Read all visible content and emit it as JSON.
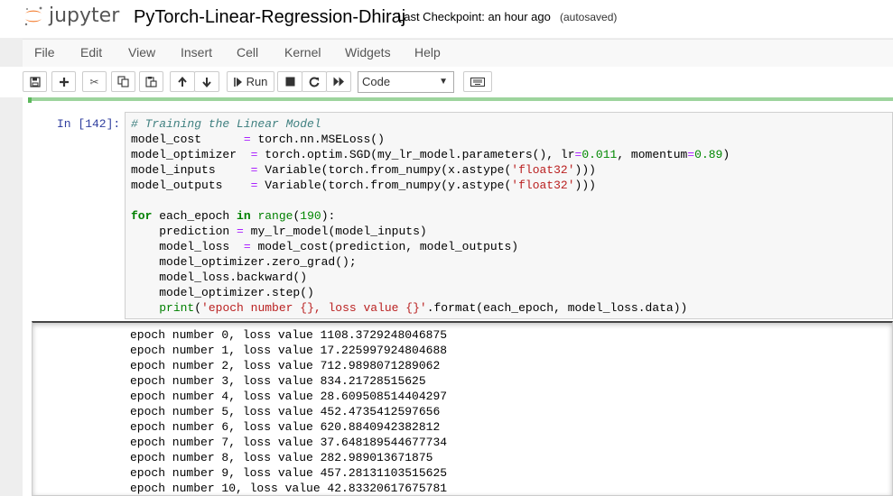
{
  "header": {
    "logo_text": "jupyter",
    "notebook_title": "PyTorch-Linear-Regression-Dhiraj",
    "checkpoint": "Last Checkpoint: an hour ago",
    "autosave": "(autosaved)"
  },
  "menu": [
    "File",
    "Edit",
    "View",
    "Insert",
    "Cell",
    "Kernel",
    "Widgets",
    "Help"
  ],
  "toolbar": {
    "icons": [
      "save-icon",
      "plus-icon",
      "cut-icon",
      "copy-icon",
      "paste-icon",
      "arrow-up-icon",
      "arrow-down-icon",
      "run-icon",
      "stop-icon",
      "restart-icon",
      "fast-forward-icon",
      "keyboard-icon"
    ],
    "run_label": "Run",
    "cell_type": "Code"
  },
  "cell": {
    "prompt": "In [142]:",
    "code": [
      [
        [
          "comment",
          "# Training the Linear Model"
        ]
      ],
      [
        [
          "",
          "model_cost      "
        ],
        [
          "operator",
          "="
        ],
        [
          "",
          " torch.nn.MSELoss()"
        ]
      ],
      [
        [
          "",
          "model_optimizer  "
        ],
        [
          "operator",
          "="
        ],
        [
          "",
          " torch.optim.SGD(my_lr_model.parameters(), lr"
        ],
        [
          "operator",
          "="
        ],
        [
          "number",
          "0.011"
        ],
        [
          "",
          ", momentum"
        ],
        [
          "operator",
          "="
        ],
        [
          "number",
          "0.89"
        ],
        [
          "",
          ")"
        ]
      ],
      [
        [
          "",
          "model_inputs     "
        ],
        [
          "operator",
          "="
        ],
        [
          "",
          " Variable(torch.from_numpy(x.astype("
        ],
        [
          "string",
          "'float32'"
        ],
        [
          "",
          ")))"
        ]
      ],
      [
        [
          "",
          "model_outputs    "
        ],
        [
          "operator",
          "="
        ],
        [
          "",
          " Variable(torch.from_numpy(y.astype("
        ],
        [
          "string",
          "'float32'"
        ],
        [
          "",
          ")))"
        ]
      ],
      [
        [
          "",
          ""
        ]
      ],
      [
        [
          "keyword",
          "for"
        ],
        [
          "",
          " each_epoch "
        ],
        [
          "keyword",
          "in"
        ],
        [
          "",
          " "
        ],
        [
          "builtin",
          "range"
        ],
        [
          "",
          "("
        ],
        [
          "number",
          "190"
        ],
        [
          "",
          "):"
        ]
      ],
      [
        [
          "",
          "    prediction "
        ],
        [
          "operator",
          "="
        ],
        [
          "",
          " my_lr_model(model_inputs)"
        ]
      ],
      [
        [
          "",
          "    model_loss  "
        ],
        [
          "operator",
          "="
        ],
        [
          "",
          " model_cost(prediction, model_outputs)"
        ]
      ],
      [
        [
          "",
          "    model_optimizer.zero_grad();"
        ]
      ],
      [
        [
          "",
          "    model_loss.backward()"
        ]
      ],
      [
        [
          "",
          "    model_optimizer.step()"
        ]
      ],
      [
        [
          "",
          "    "
        ],
        [
          "builtin",
          "print"
        ],
        [
          "",
          "("
        ],
        [
          "string",
          "'epoch number {}, loss value {}'"
        ],
        [
          "",
          ".format(each_epoch, model_loss.data))"
        ]
      ]
    ],
    "output": [
      "epoch number 0, loss value 1108.3729248046875",
      "epoch number 1, loss value 17.225997924804688",
      "epoch number 2, loss value 712.9898071289062",
      "epoch number 3, loss value 834.21728515625",
      "epoch number 4, loss value 28.609508514404297",
      "epoch number 5, loss value 452.4735412597656",
      "epoch number 6, loss value 620.8840942382812",
      "epoch number 7, loss value 37.648189544677734",
      "epoch number 8, loss value 282.989013671875",
      "epoch number 9, loss value 457.28131103515625",
      "epoch number 10, loss value 42.83320617675781"
    ]
  },
  "colors": {
    "prompt": "#303f9f",
    "progress": "#5cb85c",
    "logo_orange": "#f37726"
  }
}
